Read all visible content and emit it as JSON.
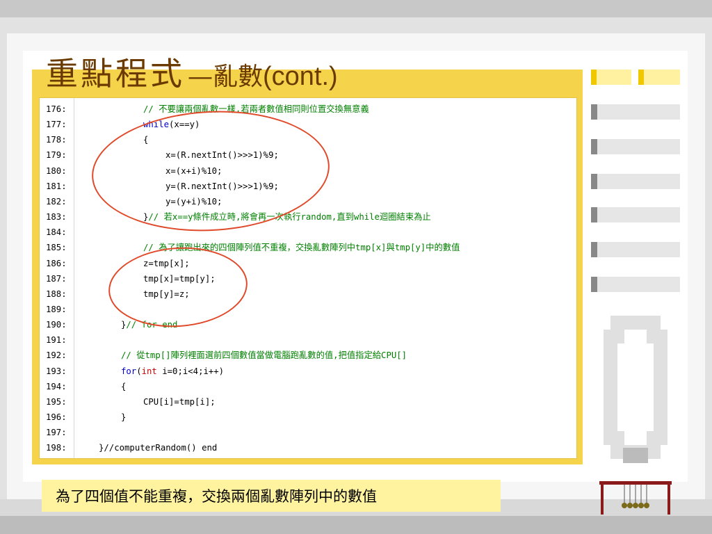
{
  "slide": {
    "title_main": "重點程式",
    "title_dash": "—亂數",
    "title_latin": "(cont.)",
    "caption": "為了四個值不能重複，交換兩個亂數陣列中的數值"
  },
  "code_lines": [
    {
      "ln": "176:",
      "cm": "// 不要讓兩個亂數一樣,若兩者數值相同則位置交換無意義"
    },
    {
      "ln": "177:",
      "kw": "while",
      "rest": "(x==y)"
    },
    {
      "ln": "178:",
      "rest": "{"
    },
    {
      "ln": "179:",
      "rest": "x=(R.nextInt()>>>1)%9;"
    },
    {
      "ln": "180:",
      "rest": "x=(x+i)%10;"
    },
    {
      "ln": "181:",
      "rest": "y=(R.nextInt()>>>1)%9;"
    },
    {
      "ln": "182:",
      "rest": "y=(y+i)%10;"
    },
    {
      "ln": "183:",
      "rest": "}",
      "cm": "// 若x==y條件成立時,將會再一次執行random,直到while迴圈結束為止"
    },
    {
      "ln": "184:"
    },
    {
      "ln": "185:",
      "cm": "// 為了讓跑出來的四個陣列值不重複，交換亂數陣列中tmp[x]與tmp[y]中的數值"
    },
    {
      "ln": "186:",
      "rest": "z=tmp[x];"
    },
    {
      "ln": "187:",
      "rest": "tmp[x]=tmp[y];"
    },
    {
      "ln": "188:",
      "rest": "tmp[y]=z;"
    },
    {
      "ln": "189:"
    },
    {
      "ln": "190:",
      "rest": "}",
      "cm": "// for end"
    },
    {
      "ln": "191:"
    },
    {
      "ln": "192:",
      "cm": "// 從tmp[]陣列裡面選前四個數值當做電腦跑亂數的值,把值指定給CPU[]"
    },
    {
      "ln": "193:",
      "kw": "for",
      "rest": "(",
      "ty": "int",
      "rest2": " i=0;i<4;i++)"
    },
    {
      "ln": "194:",
      "rest": "{"
    },
    {
      "ln": "195:",
      "rest": "CPU[i]=tmp[i];"
    },
    {
      "ln": "196:",
      "rest": "}"
    },
    {
      "ln": "197:"
    },
    {
      "ln": "198:",
      "rest": "}//computerRandom() end"
    }
  ],
  "colors": {
    "title": "#6b3a00",
    "panel_border": "#f5d34a",
    "annotation": "#e04a2a",
    "comment": "#008000",
    "keyword": "#0000cc",
    "type": "#cc0000"
  }
}
